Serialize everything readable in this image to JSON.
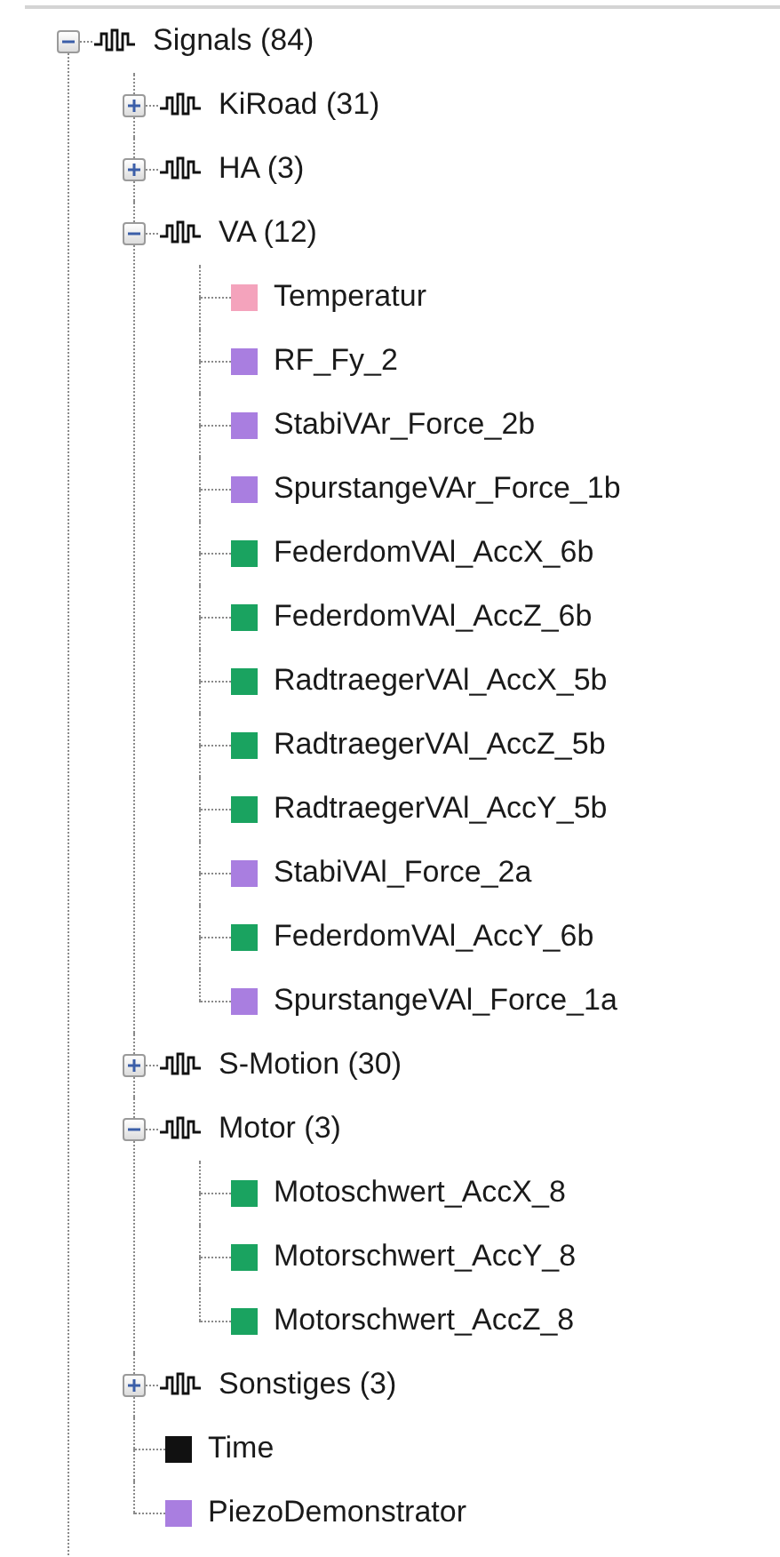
{
  "tree": [
    {
      "kind": "group",
      "label": "Signals (84)",
      "expanded": true,
      "children": [
        {
          "kind": "group",
          "label": "KiRoad (31)",
          "expanded": false
        },
        {
          "kind": "group",
          "label": "HA (3)",
          "expanded": false
        },
        {
          "kind": "group",
          "label": "VA (12)",
          "expanded": true,
          "children": [
            {
              "kind": "signal",
              "label": "Temperatur",
              "color": "#f4a3bc"
            },
            {
              "kind": "signal",
              "label": "RF_Fy_2",
              "color": "#a97ee0"
            },
            {
              "kind": "signal",
              "label": "StabiVAr_Force_2b",
              "color": "#a97ee0"
            },
            {
              "kind": "signal",
              "label": "SpurstangeVAr_Force_1b",
              "color": "#a97ee0"
            },
            {
              "kind": "signal",
              "label": "FederdomVAl_AccX_6b",
              "color": "#1aa360"
            },
            {
              "kind": "signal",
              "label": "FederdomVAl_AccZ_6b",
              "color": "#1aa360"
            },
            {
              "kind": "signal",
              "label": "RadtraegerVAl_AccX_5b",
              "color": "#1aa360"
            },
            {
              "kind": "signal",
              "label": "RadtraegerVAl_AccZ_5b",
              "color": "#1aa360"
            },
            {
              "kind": "signal",
              "label": "RadtraegerVAl_AccY_5b",
              "color": "#1aa360"
            },
            {
              "kind": "signal",
              "label": "StabiVAl_Force_2a",
              "color": "#a97ee0"
            },
            {
              "kind": "signal",
              "label": "FederdomVAl_AccY_6b",
              "color": "#1aa360"
            },
            {
              "kind": "signal",
              "label": "SpurstangeVAl_Force_1a",
              "color": "#a97ee0"
            }
          ]
        },
        {
          "kind": "group",
          "label": "S-Motion (30)",
          "expanded": false
        },
        {
          "kind": "group",
          "label": "Motor (3)",
          "expanded": true,
          "children": [
            {
              "kind": "signal",
              "label": "Motoschwert_AccX_8",
              "color": "#1aa360"
            },
            {
              "kind": "signal",
              "label": "Motorschwert_AccY_8",
              "color": "#1aa360"
            },
            {
              "kind": "signal",
              "label": "Motorschwert_AccZ_8",
              "color": "#1aa360"
            }
          ]
        },
        {
          "kind": "group",
          "label": "Sonstiges (3)",
          "expanded": false
        },
        {
          "kind": "signal",
          "label": "Time",
          "color": "#111111"
        },
        {
          "kind": "signal",
          "label": "PiezoDemonstrator",
          "color": "#a97ee0"
        }
      ]
    }
  ]
}
